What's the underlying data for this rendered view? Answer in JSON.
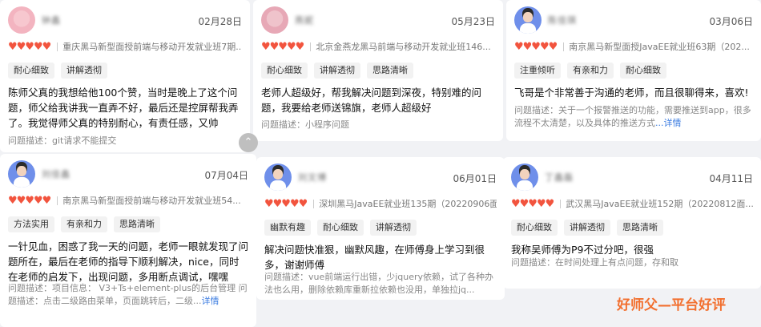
{
  "reviews": [
    {
      "name": "钟鑫",
      "date": "02月28日",
      "course": "重庆黑马新型面授前端与移动开发就业班7期...",
      "tags": [
        "耐心细致",
        "讲解透彻"
      ],
      "text": "陈师父真的我想给他100个赞，当时是晚上了这个问题，师父给我讲我一直弄不好，最后还是控屏帮我弄了。我觉得师父真的特别耐心，有责任感，又帅",
      "desc": "问题描述：git请求不能提交"
    },
    {
      "name": "燕妮",
      "date": "05月23日",
      "course": "北京金燕龙黑马前端与移动开发就业班146...",
      "tags": [
        "耐心细致",
        "讲解透彻",
        "思路清晰"
      ],
      "text": "老师人超级好，帮我解决问题到深夜，特别难的问题，我要给老师送锦旗，老师人超级好",
      "desc": "问题描述：小程序问题"
    },
    {
      "name": "陈佳琪",
      "date": "03月06日",
      "course": "南京黑马新型面授JavaEE就业班63期（202...",
      "tags": [
        "注重倾听",
        "有亲和力",
        "耐心细致"
      ],
      "text": "飞哥是个非常善于沟通的老师，而且很聊得来，喜欢!",
      "desc": "问题描述：关于一个报警推送的功能，需要推送到app，很多流程不太清楚，以及具体的推送方式",
      "more": "...详情"
    },
    {
      "name": "刘佳鑫",
      "date": "07月04日",
      "course": "南京黑马新型面授前端与移动开发就业班54...",
      "tags": [
        "方法实用",
        "有亲和力",
        "思路清晰"
      ],
      "text": "一针见血，困惑了我一天的问题，老师一眼就发现了问题所在，最后在老师的指导下顺利解决，nice，同时在老师的启发下，出现问题，多用断点调试，嘿嘿",
      "desc": "问题描述：项目信息： V3+Ts+element-plus的后台管理 问题描述：点击二级路由菜单，页面跳转后，二级...",
      "more": "详情"
    },
    {
      "name": "刘文博",
      "date": "06月01日",
      "course": "深圳黑马JavaEE就业班135期（20220906面...",
      "tags": [
        "幽默有趣",
        "耐心细致",
        "讲解透彻"
      ],
      "text": "解决问题快准狠，幽默风趣，在师傅身上学习到很多，谢谢师傅",
      "desc": "问题描述：vue前端运行出错，少jquery依赖，试了各种办法也么用，删除依赖库重新拉依赖也没用，单独拉jq..."
    },
    {
      "name": "丁鑫磊",
      "date": "04月11日",
      "course": "武汉黑马JavaEE就业班152期（20220812面...",
      "tags": [
        "耐心细致",
        "讲解透彻",
        "思路清晰"
      ],
      "text": "我称吴师傅为P9不过分吧，很强",
      "desc": "问题描述：在时间处理上有点问题，存和取"
    }
  ],
  "stars": "♥♥♥♥♥",
  "fab_icon": "⌃",
  "watermark": "好师父—平台好评",
  "colors": {
    "star": "#f2543e",
    "link": "#3a7be0",
    "watermark": "#f26f2e"
  }
}
